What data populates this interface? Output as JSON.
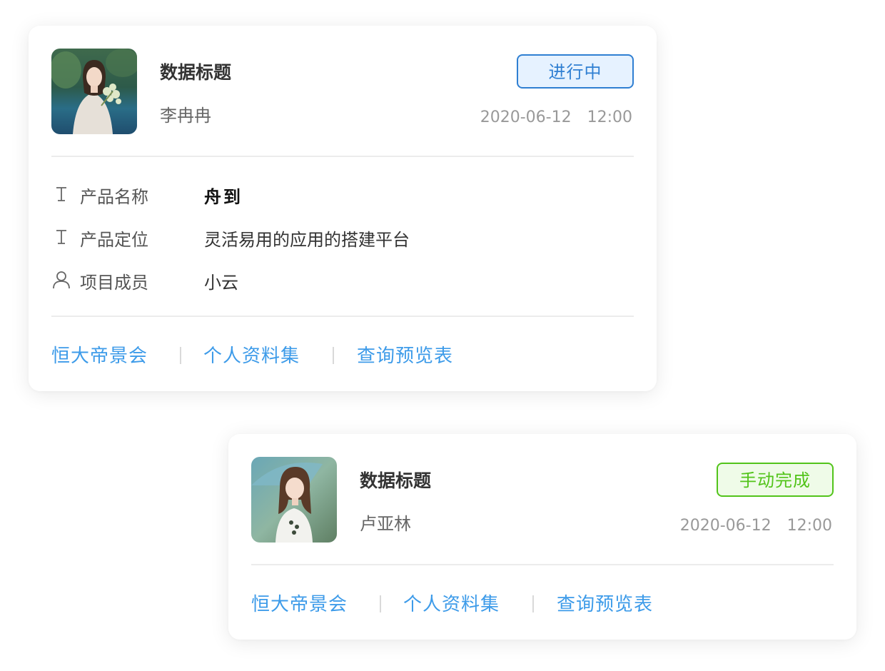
{
  "colors": {
    "accent_blue": "#2f7fd2",
    "badge_blue_bg": "#e6f2ff",
    "accent_green": "#52c41a",
    "badge_green_bg": "#effbe8",
    "link": "#3d9be9",
    "muted": "#999999"
  },
  "cards": [
    {
      "avatar": "photo-woman-with-flowers",
      "title": "数据标题",
      "name": "李冉冉",
      "status": "进行中",
      "date": "2020-06-12",
      "time": "12:00",
      "fields": [
        {
          "icon": "text-icon",
          "label": "产品名称",
          "value": "舟到"
        },
        {
          "icon": "text-icon",
          "label": "产品定位",
          "value": "灵活易用的应用的搭建平台"
        },
        {
          "icon": "user-icon",
          "label": "项目成员",
          "value": "小云"
        }
      ],
      "links": [
        "恒大帝景会",
        "个人资料集",
        "查询预览表"
      ]
    },
    {
      "avatar": "photo-girl-with-umbrella",
      "title": "数据标题",
      "name": "卢亚林",
      "status": "手动完成",
      "date": "2020-06-12",
      "time": "12:00",
      "links": [
        "恒大帝景会",
        "个人资料集",
        "查询预览表"
      ]
    }
  ]
}
